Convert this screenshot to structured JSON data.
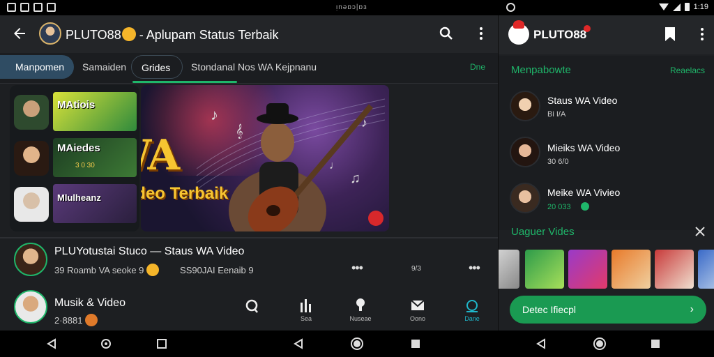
{
  "status_bar": {
    "center_text": "ᴉnəɒɔ|ɒɜ",
    "time": "1:19"
  },
  "left": {
    "header": {
      "title": "PLUTO88",
      "subtitle": "- Aplupam Status Terbaik"
    },
    "tabs": [
      {
        "label": "Manpomen"
      },
      {
        "label": "Samaiden"
      },
      {
        "label": "Grides"
      },
      {
        "label": "Stondanal Nos WA  Kejpnanu"
      },
      {
        "label": "Dne"
      }
    ],
    "thumbs": [
      {
        "label": "MAtiois",
        "sub": ""
      },
      {
        "label": "MAiedes",
        "sub": "3 0 30"
      },
      {
        "label": "Mlulheanz",
        "sub": ""
      }
    ],
    "hero": {
      "big": "WA",
      "sub": "Video Terbaik"
    },
    "feed": [
      {
        "title": "PLUYotustai  Stuco — Staus WA Video",
        "meta_a": "39  Roamb VA  seoke 9",
        "meta_b": "SS90JAI Eenaib 9",
        "meta_c": "9/3"
      },
      {
        "title": "Musik & Video",
        "meta_a": "2·8881"
      }
    ],
    "bottom_tabs": [
      {
        "label": ""
      },
      {
        "label": "Sea"
      },
      {
        "label": "Nuseae"
      },
      {
        "label": "Oono"
      },
      {
        "label": "Dane"
      }
    ]
  },
  "right": {
    "header": {
      "title": "PLUTO88"
    },
    "section1": {
      "heading": "Menpabowte",
      "link": "Reaelacs"
    },
    "items": [
      {
        "title": "Staus WA Video",
        "meta": "Bi   I/A"
      },
      {
        "title": "Mieiks WA Video",
        "meta": "30  6/0"
      },
      {
        "title": "Meike WA Vivieo",
        "meta": "20  033"
      }
    ],
    "section2": {
      "heading": "Uaguer Vides"
    },
    "cta": {
      "label": "Detec Ifiecpl",
      "chevron": "›"
    }
  },
  "colors": {
    "accent_green": "#1fb66a",
    "tab_active": "#2f4c63",
    "gold": "#f7c531",
    "bg": "#1d1f22"
  },
  "icons": [
    "back-arrow-icon",
    "search-icon",
    "more-vert-icon",
    "bookmark-icon",
    "close-expand-icon",
    "chevron-right-icon",
    "nav-back-icon",
    "nav-home-icon",
    "nav-recents-icon"
  ]
}
